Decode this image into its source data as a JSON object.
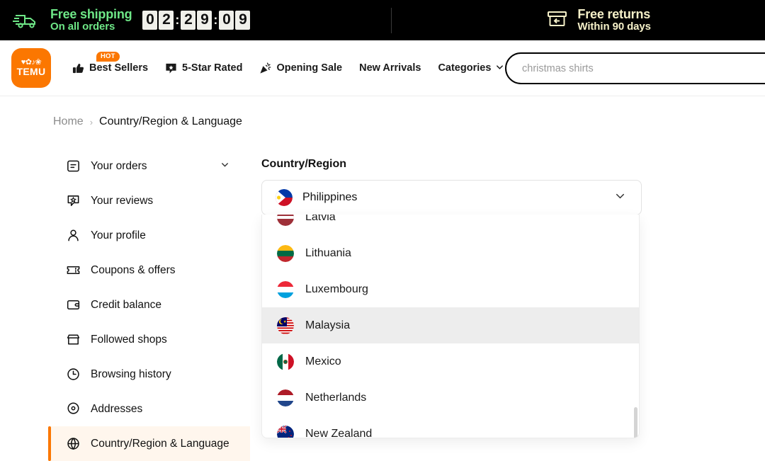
{
  "promo": {
    "shipping_title": "Free shipping",
    "shipping_sub": "On all orders",
    "countdown": {
      "d1": "0",
      "d2": "2",
      "d3": "2",
      "d4": "9",
      "d5": "0",
      "d6": "9",
      "sep1": ":",
      "sep2": ":"
    },
    "returns_title": "Free returns",
    "returns_sub": "Within 90 days",
    "truck_icon": "delivery-truck-icon",
    "returns_icon": "return-box-icon",
    "green": "#6ee787",
    "cream": "#f5f0c8"
  },
  "brand": {
    "glyphs": "♥✿♪❀",
    "word": "TEMU",
    "color": "#fb7701"
  },
  "nav": {
    "items": [
      {
        "label": "Best Sellers",
        "icon": "thumbs-up-icon",
        "badge": "HOT"
      },
      {
        "label": "5-Star Rated",
        "icon": "star-badge-icon",
        "badge": ""
      },
      {
        "label": "Opening Sale",
        "icon": "party-popper-icon",
        "badge": ""
      },
      {
        "label": "New Arrivals",
        "icon": "",
        "badge": ""
      },
      {
        "label": "Categories",
        "icon": "",
        "badge": "",
        "chevron": "chevron-down-icon"
      }
    ]
  },
  "search": {
    "value": "",
    "placeholder": "christmas shirts",
    "icon": "search-icon"
  },
  "breadcrumb": {
    "home": "Home",
    "separator": "›",
    "current": "Country/Region & Language"
  },
  "sidebar": {
    "items": [
      {
        "label": "Your orders",
        "icon": "orders-list-icon",
        "chevron": "chevron-down-icon",
        "active": false
      },
      {
        "label": "Your reviews",
        "icon": "review-star-bubble-icon",
        "active": false
      },
      {
        "label": "Your profile",
        "icon": "person-icon",
        "active": false
      },
      {
        "label": "Coupons & offers",
        "icon": "coupon-ticket-icon",
        "active": false
      },
      {
        "label": "Credit balance",
        "icon": "wallet-icon",
        "active": false
      },
      {
        "label": "Followed shops",
        "icon": "storefront-icon",
        "active": false
      },
      {
        "label": "Browsing history",
        "icon": "clock-icon",
        "active": false
      },
      {
        "label": "Addresses",
        "icon": "location-pin-icon",
        "active": false
      },
      {
        "label": "Country/Region & Language",
        "icon": "globe-icon",
        "active": true
      }
    ],
    "active_color": "#fb7701",
    "active_bg": "#fff6ed"
  },
  "main": {
    "field_label": "Country/Region",
    "selected": {
      "label": "Philippines",
      "flag": "flag-philippines"
    },
    "chevron": "chevron-down-icon",
    "dropdown": {
      "highlight_color": "#ededed",
      "options": [
        {
          "label": "Latvia",
          "flag": "flag-latvia",
          "highlighted": false
        },
        {
          "label": "Lithuania",
          "flag": "flag-lithuania",
          "highlighted": false
        },
        {
          "label": "Luxembourg",
          "flag": "flag-luxembourg",
          "highlighted": false
        },
        {
          "label": "Malaysia",
          "flag": "flag-malaysia",
          "highlighted": true
        },
        {
          "label": "Mexico",
          "flag": "flag-mexico",
          "highlighted": false
        },
        {
          "label": "Netherlands",
          "flag": "flag-netherlands",
          "highlighted": false
        },
        {
          "label": "New Zealand",
          "flag": "flag-new-zealand",
          "highlighted": false
        }
      ]
    }
  }
}
